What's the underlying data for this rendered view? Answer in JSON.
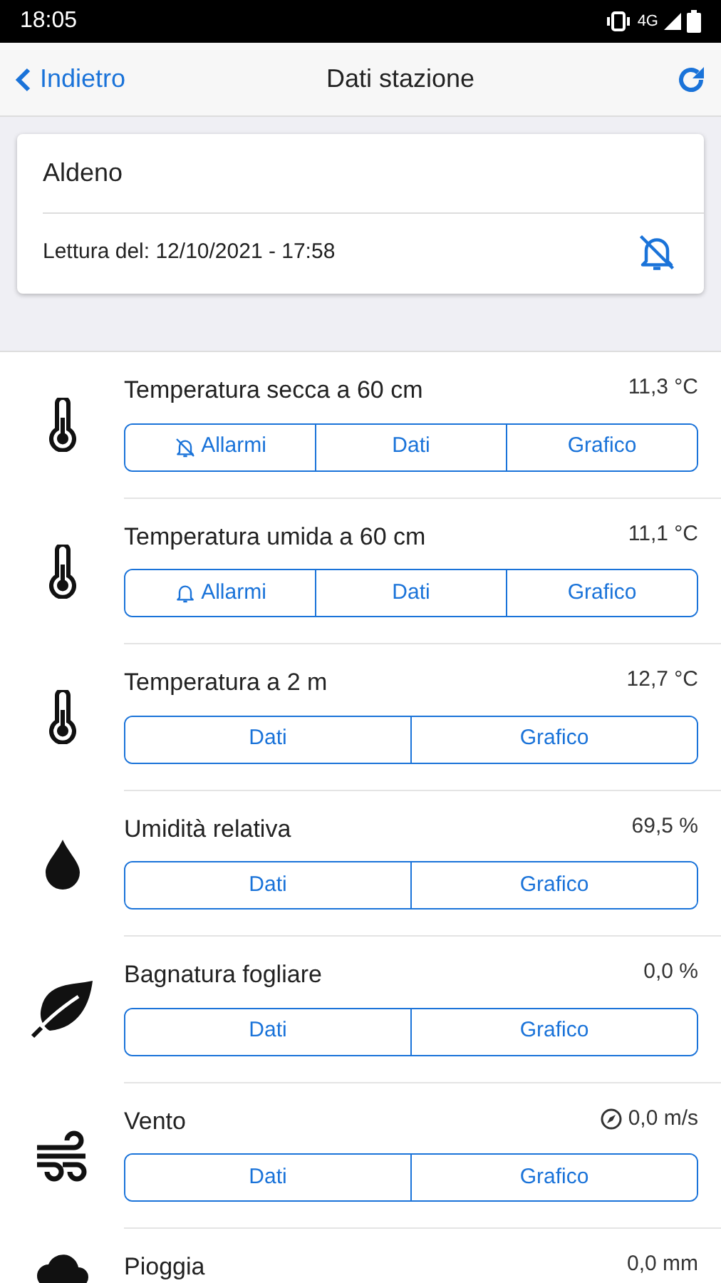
{
  "status_bar": {
    "time": "18:05",
    "network": "4G"
  },
  "nav": {
    "back": "Indietro",
    "title": "Dati stazione"
  },
  "station": {
    "name": "Aldeno",
    "reading": "Lettura del: 12/10/2021 - 17:58",
    "alarms_muted": true
  },
  "sensors": [
    {
      "kind": "thermometer",
      "name": "Temperatura secca a 60 cm",
      "value": "11,3 °C",
      "direction": false,
      "buttons": [
        {
          "kind": "alarms",
          "label": "Allarmi",
          "muted": true
        },
        {
          "kind": "data",
          "label": "Dati"
        },
        {
          "kind": "chart",
          "label": "Grafico"
        }
      ]
    },
    {
      "kind": "thermometer",
      "name": "Temperatura umida a 60 cm",
      "value": "11,1 °C",
      "direction": false,
      "buttons": [
        {
          "kind": "alarms",
          "label": "Allarmi",
          "muted": false
        },
        {
          "kind": "data",
          "label": "Dati"
        },
        {
          "kind": "chart",
          "label": "Grafico"
        }
      ]
    },
    {
      "kind": "thermometer",
      "name": "Temperatura a 2 m",
      "value": "12,7 °C",
      "direction": false,
      "buttons": [
        {
          "kind": "data",
          "label": "Dati"
        },
        {
          "kind": "chart",
          "label": "Grafico"
        }
      ]
    },
    {
      "kind": "drop",
      "name": "Umidità relativa",
      "value": "69,5 %",
      "direction": false,
      "buttons": [
        {
          "kind": "data",
          "label": "Dati"
        },
        {
          "kind": "chart",
          "label": "Grafico"
        }
      ]
    },
    {
      "kind": "leaf",
      "name": "Bagnatura fogliare",
      "value": "0,0 %",
      "direction": false,
      "buttons": [
        {
          "kind": "data",
          "label": "Dati"
        },
        {
          "kind": "chart",
          "label": "Grafico"
        }
      ]
    },
    {
      "kind": "wind",
      "name": "Vento",
      "value": "0,0 m/s",
      "direction": true,
      "buttons": [
        {
          "kind": "data",
          "label": "Dati"
        },
        {
          "kind": "chart",
          "label": "Grafico"
        }
      ]
    },
    {
      "kind": "cloud",
      "name": "Pioggia",
      "value": "0,0 mm",
      "direction": false
    }
  ]
}
